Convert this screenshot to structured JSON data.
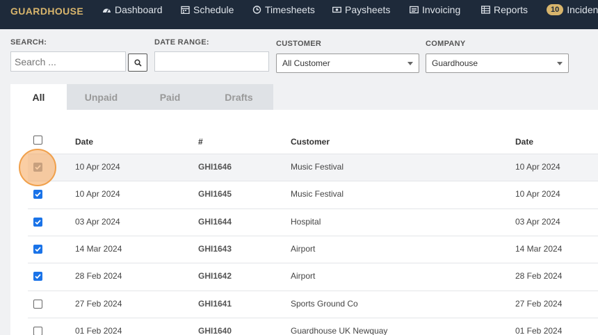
{
  "nav": {
    "brand": "GUARDHOUSE",
    "items": [
      {
        "label": "Dashboard",
        "icon": "dashboard-icon"
      },
      {
        "label": "Schedule",
        "icon": "calendar-icon"
      },
      {
        "label": "Timesheets",
        "icon": "clock-icon"
      },
      {
        "label": "Paysheets",
        "icon": "money-icon"
      },
      {
        "label": "Invoicing",
        "icon": "invoice-icon"
      },
      {
        "label": "Reports",
        "icon": "reports-icon"
      }
    ],
    "incidents_badge": "10",
    "incidents_label": "Incident"
  },
  "filters": {
    "search_label": "SEARCH:",
    "search_placeholder": "Search ...",
    "date_range_label": "DATE RANGE:",
    "date_range_value": "",
    "customer_label": "CUSTOMER",
    "customer_value": "All Customer",
    "company_label": "COMPANY",
    "company_value": "Guardhouse"
  },
  "tabs": [
    "All",
    "Unpaid",
    "Paid",
    "Drafts"
  ],
  "active_tab": "All",
  "table": {
    "headers": [
      "Date",
      "#",
      "Customer",
      "Date"
    ],
    "rows": [
      {
        "date": "10 Apr 2024",
        "num": "GHI1646",
        "customer": "Music Festival",
        "date2": "10 Apr 2024",
        "checked": true
      },
      {
        "date": "10 Apr 2024",
        "num": "GHI1645",
        "customer": "Music Festival",
        "date2": "10 Apr 2024",
        "checked": true
      },
      {
        "date": "03 Apr 2024",
        "num": "GHI1644",
        "customer": "Hospital",
        "date2": "03 Apr 2024",
        "checked": true
      },
      {
        "date": "14 Mar 2024",
        "num": "GHI1643",
        "customer": "Airport",
        "date2": "14 Mar 2024",
        "checked": true
      },
      {
        "date": "28 Feb 2024",
        "num": "GHI1642",
        "customer": "Airport",
        "date2": "28 Feb 2024",
        "checked": true
      },
      {
        "date": "27 Feb 2024",
        "num": "GHI1641",
        "customer": "Sports Ground Co",
        "date2": "27 Feb 2024",
        "checked": false
      },
      {
        "date": "01 Feb 2024",
        "num": "GHI1640",
        "customer": "Guardhouse UK Newquay",
        "date2": "01 Feb 2024",
        "checked": false
      }
    ]
  },
  "colors": {
    "nav_bg": "#1e2a3a",
    "brand": "#d8b56c",
    "checkbox": "#1a73e8",
    "highlight_ring": "#f0a04b"
  }
}
